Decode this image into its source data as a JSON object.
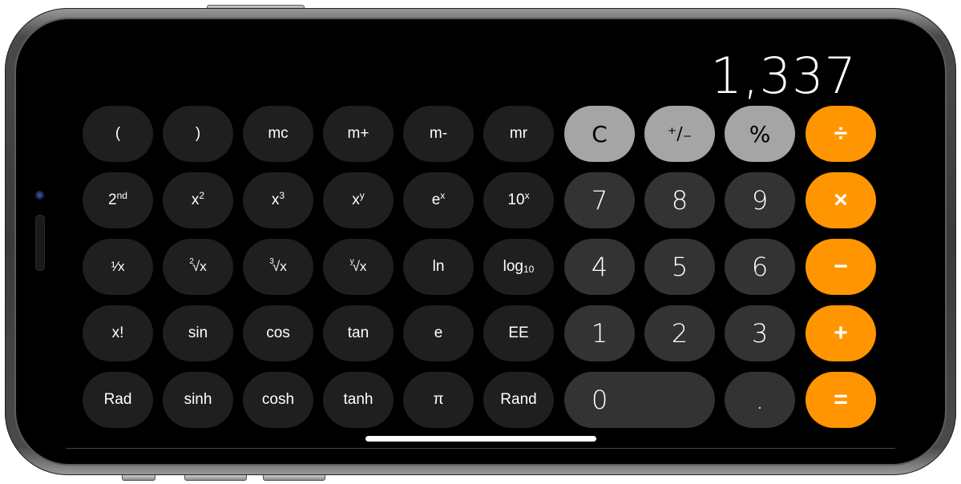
{
  "display": {
    "value": "1,337"
  },
  "colors": {
    "scientific_key": "#1f1f1f",
    "number_key": "#333333",
    "function_key": "#a5a5a5",
    "operator_key": "#ff9500",
    "background": "#000000"
  },
  "keys": {
    "open_paren": "(",
    "close_paren": ")",
    "mc": "mc",
    "m_plus": "m+",
    "m_minus": "m-",
    "mr": "mr",
    "clear": "C",
    "plus_minus": "⁺∕₋",
    "percent": "%",
    "divide": "÷",
    "second": {
      "base": "2",
      "sup": "nd"
    },
    "x_squared": {
      "base": "x",
      "sup": "2"
    },
    "x_cubed": {
      "base": "x",
      "sup": "3"
    },
    "x_pow_y": {
      "base": "x",
      "sup": "y"
    },
    "e_pow_x": {
      "base": "e",
      "sup": "x"
    },
    "ten_pow_x": {
      "base": "10",
      "sup": "x"
    },
    "seven": "7",
    "eight": "8",
    "nine": "9",
    "multiply": "×",
    "reciprocal": "¹∕x",
    "sqrt": {
      "pre": "2",
      "base": "√x"
    },
    "cbrt": {
      "pre": "3",
      "base": "√x"
    },
    "yroot": {
      "pre": "y",
      "base": "√x"
    },
    "ln": "ln",
    "log10": {
      "base": "log",
      "sub": "10"
    },
    "four": "4",
    "five": "5",
    "six": "6",
    "minus": "−",
    "factorial": "x!",
    "sin": "sin",
    "cos": "cos",
    "tan": "tan",
    "e": "e",
    "ee": "EE",
    "one": "1",
    "two": "2",
    "three": "3",
    "plus": "+",
    "rad": "Rad",
    "sinh": "sinh",
    "cosh": "cosh",
    "tanh": "tanh",
    "pi": "π",
    "rand": "Rand",
    "zero": "0",
    "decimal": ".",
    "equals": "="
  }
}
